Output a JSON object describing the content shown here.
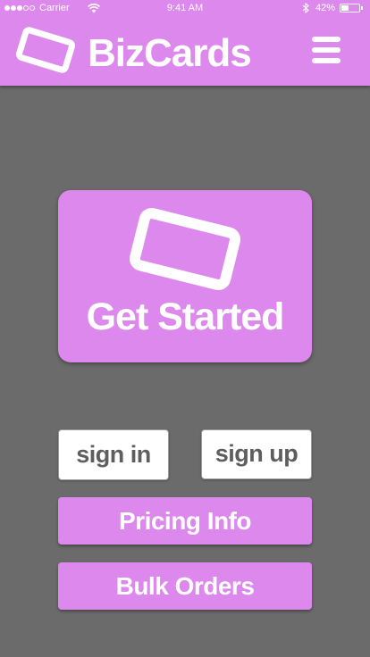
{
  "status_bar": {
    "carrier": "Carrier",
    "time": "9:41 AM",
    "battery_percent": "42%",
    "battery_level": 0.42,
    "signal_bars_filled": 3,
    "signal_bars_total": 5
  },
  "header": {
    "brand": "BizCards",
    "logo_icon": "card-icon",
    "menu_icon": "hamburger-menu-icon"
  },
  "hero": {
    "label": "Get Started",
    "icon": "card-icon"
  },
  "auth": {
    "sign_in": "sign in",
    "sign_up": "sign up"
  },
  "actions": {
    "pricing": "Pricing Info",
    "bulk": "Bulk Orders"
  },
  "colors": {
    "accent": "#dc88ec",
    "background": "#6b6b6b",
    "button_text": "#5e5e5e"
  }
}
